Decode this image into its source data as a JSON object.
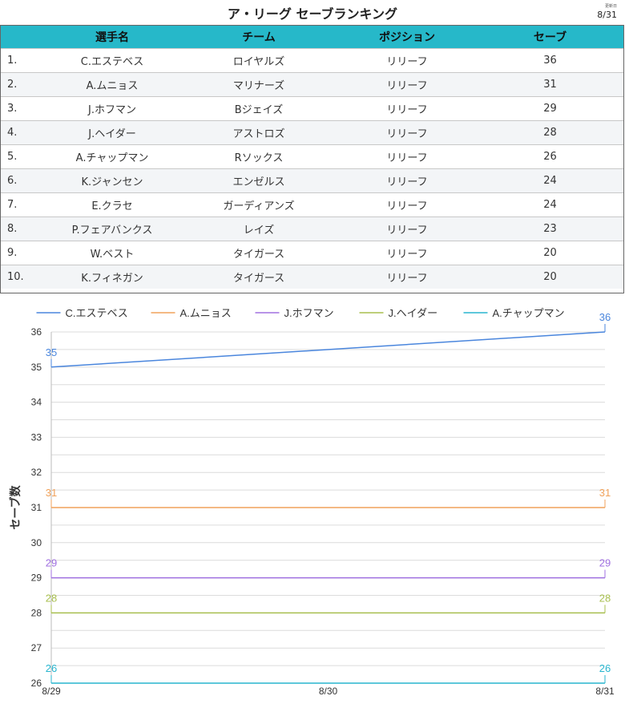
{
  "header": {
    "title": "ア・リーグ セーブランキング",
    "updated_label": "更新日",
    "updated_date": "8/31"
  },
  "table": {
    "columns": [
      "選手名",
      "チーム",
      "ポジション",
      "セーブ"
    ],
    "rows": [
      {
        "rank": "1.",
        "player": "C.エステベス",
        "team": "ロイヤルズ",
        "position": "リリーフ",
        "saves": "36"
      },
      {
        "rank": "2.",
        "player": "A.ムニョス",
        "team": "マリナーズ",
        "position": "リリーフ",
        "saves": "31"
      },
      {
        "rank": "3.",
        "player": "J.ホフマン",
        "team": "Bジェイズ",
        "position": "リリーフ",
        "saves": "29"
      },
      {
        "rank": "4.",
        "player": "J.ヘイダー",
        "team": "アストロズ",
        "position": "リリーフ",
        "saves": "28"
      },
      {
        "rank": "5.",
        "player": "A.チャップマン",
        "team": "Rソックス",
        "position": "リリーフ",
        "saves": "26"
      },
      {
        "rank": "6.",
        "player": "K.ジャンセン",
        "team": "エンゼルス",
        "position": "リリーフ",
        "saves": "24"
      },
      {
        "rank": "7.",
        "player": "E.クラセ",
        "team": "ガーディアンズ",
        "position": "リリーフ",
        "saves": "24"
      },
      {
        "rank": "8.",
        "player": "P.フェアバンクス",
        "team": "レイズ",
        "position": "リリーフ",
        "saves": "23"
      },
      {
        "rank": "9.",
        "player": "W.ベスト",
        "team": "タイガース",
        "position": "リリーフ",
        "saves": "20"
      },
      {
        "rank": "10.",
        "player": "K.フィネガン",
        "team": "タイガース",
        "position": "リリーフ",
        "saves": "20"
      }
    ]
  },
  "chart_data": {
    "type": "line",
    "ylabel": "セーブ数",
    "x": [
      "8/29",
      "8/30",
      "8/31"
    ],
    "ylim": [
      26,
      36
    ],
    "yticks": [
      26,
      27,
      28,
      29,
      30,
      31,
      32,
      33,
      34,
      35,
      36
    ],
    "grid": true,
    "legend_position": "top",
    "series": [
      {
        "name": "C.エステベス",
        "color": "#4a86dd",
        "points": [
          {
            "x": "8/29",
            "y": 35
          },
          {
            "x": "8/31",
            "y": 36
          }
        ]
      },
      {
        "name": "A.ムニョス",
        "color": "#f0a25b",
        "points": [
          {
            "x": "8/29",
            "y": 31
          },
          {
            "x": "8/31",
            "y": 31
          }
        ]
      },
      {
        "name": "J.ホフマン",
        "color": "#a070e0",
        "points": [
          {
            "x": "8/29",
            "y": 29
          },
          {
            "x": "8/31",
            "y": 29
          }
        ]
      },
      {
        "name": "J.ヘイダー",
        "color": "#a8bf4f",
        "points": [
          {
            "x": "8/29",
            "y": 28
          },
          {
            "x": "8/31",
            "y": 28
          }
        ]
      },
      {
        "name": "A.チャップマン",
        "color": "#29b6cf",
        "points": [
          {
            "x": "8/29",
            "y": 26
          },
          {
            "x": "8/31",
            "y": 26
          }
        ]
      }
    ]
  }
}
